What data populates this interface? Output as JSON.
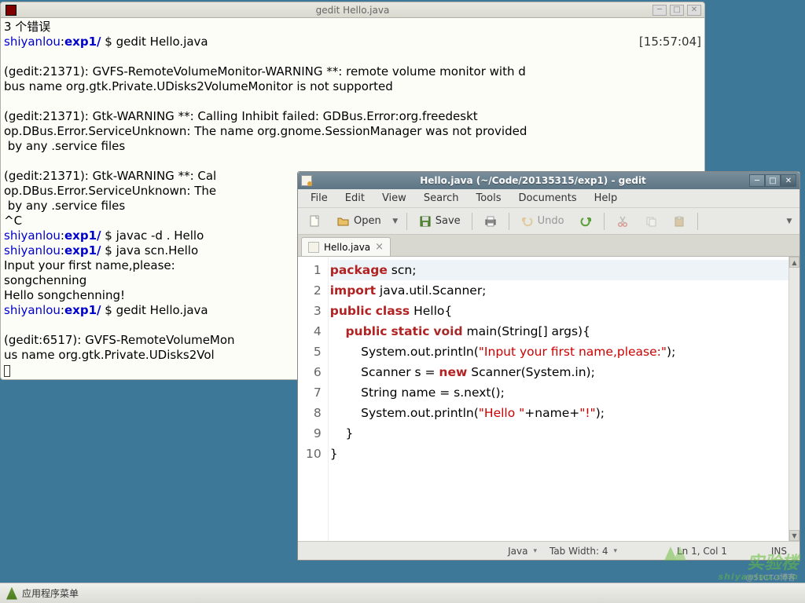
{
  "terminal": {
    "title": "gedit Hello.java",
    "lines": [
      {
        "segments": [
          {
            "t": "3 个错误"
          }
        ]
      },
      {
        "segments": [
          {
            "t": "shiyanlou",
            "cls": "prompt-host"
          },
          {
            "t": ":"
          },
          {
            "t": "exp1/",
            "cls": "prompt-path"
          },
          {
            "t": " $ gedit Hello.java"
          }
        ],
        "right": "[15:57:04]"
      },
      {
        "segments": [
          {
            "t": " "
          }
        ]
      },
      {
        "segments": [
          {
            "t": "(gedit:21371): GVFS-RemoteVolumeMonitor-WARNING **: remote volume monitor with d"
          }
        ]
      },
      {
        "segments": [
          {
            "t": "bus name org.gtk.Private.UDisks2VolumeMonitor is not supported"
          }
        ]
      },
      {
        "segments": [
          {
            "t": " "
          }
        ]
      },
      {
        "segments": [
          {
            "t": "(gedit:21371): Gtk-WARNING **: Calling Inhibit failed: GDBus.Error:org.freedeskt"
          }
        ]
      },
      {
        "segments": [
          {
            "t": "op.DBus.Error.ServiceUnknown: The name org.gnome.SessionManager was not provided"
          }
        ]
      },
      {
        "segments": [
          {
            "t": " by any .service files"
          }
        ]
      },
      {
        "segments": [
          {
            "t": " "
          }
        ]
      },
      {
        "segments": [
          {
            "t": "(gedit:21371): Gtk-WARNING **: Cal"
          }
        ]
      },
      {
        "segments": [
          {
            "t": "op.DBus.Error.ServiceUnknown: The "
          }
        ]
      },
      {
        "segments": [
          {
            "t": " by any .service files"
          }
        ]
      },
      {
        "segments": [
          {
            "t": "^C"
          }
        ]
      },
      {
        "segments": [
          {
            "t": "shiyanlou",
            "cls": "prompt-host"
          },
          {
            "t": ":"
          },
          {
            "t": "exp1/",
            "cls": "prompt-path"
          },
          {
            "t": " $ javac -d . Hello"
          }
        ]
      },
      {
        "segments": [
          {
            "t": "shiyanlou",
            "cls": "prompt-host"
          },
          {
            "t": ":"
          },
          {
            "t": "exp1/",
            "cls": "prompt-path"
          },
          {
            "t": " $ java scn.Hello"
          }
        ]
      },
      {
        "segments": [
          {
            "t": "Input your first name,please:"
          }
        ]
      },
      {
        "segments": [
          {
            "t": "songchenning"
          }
        ]
      },
      {
        "segments": [
          {
            "t": "Hello songchenning!"
          }
        ]
      },
      {
        "segments": [
          {
            "t": "shiyanlou",
            "cls": "prompt-host"
          },
          {
            "t": ":"
          },
          {
            "t": "exp1/",
            "cls": "prompt-path"
          },
          {
            "t": " $ gedit Hello.java"
          }
        ]
      },
      {
        "segments": [
          {
            "t": " "
          }
        ]
      },
      {
        "segments": [
          {
            "t": "(gedit:6517): GVFS-RemoteVolumeMon"
          }
        ]
      },
      {
        "segments": [
          {
            "t": "us name org.gtk.Private.UDisks2Vol"
          }
        ]
      }
    ]
  },
  "gedit": {
    "title": "Hello.java (~/Code/20135315/exp1) - gedit",
    "menus": [
      "File",
      "Edit",
      "View",
      "Search",
      "Tools",
      "Documents",
      "Help"
    ],
    "toolbar": {
      "open": "Open",
      "save": "Save",
      "undo": "Undo"
    },
    "tab": "Hello.java",
    "code_lines": [
      {
        "n": "1",
        "hl": true,
        "html": "<span class=\"kw\">package</span> scn;"
      },
      {
        "n": "2",
        "html": "<span class=\"kw\">import</span> java.util.Scanner;"
      },
      {
        "n": "3",
        "html": "<span class=\"kw\">public</span> <span class=\"kw\">class</span> Hello{"
      },
      {
        "n": "4",
        "html": "    <span class=\"kw\">public</span> <span class=\"kw\">static</span> <span class=\"kw2\">void</span> main(String[] args){"
      },
      {
        "n": "5",
        "html": "        System.out.println(<span class=\"str\">\"Input your first name,please:\"</span>);"
      },
      {
        "n": "6",
        "html": "        Scanner s = <span class=\"kw\">new</span> Scanner(System.in);"
      },
      {
        "n": "7",
        "html": "        String name = s.next();"
      },
      {
        "n": "8",
        "html": "        System.out.println(<span class=\"str\">\"Hello \"</span>+name+<span class=\"str\">\"!\"</span>);"
      },
      {
        "n": "9",
        "html": "    }"
      },
      {
        "n": "10",
        "html": "}"
      }
    ],
    "status": {
      "lang": "Java",
      "tabwidth": "Tab Width: 4",
      "pos": "Ln 1, Col 1",
      "ins": "INS"
    }
  },
  "taskbar": {
    "menu": "应用程序菜单"
  },
  "watermark": {
    "main": "实验楼",
    "sub": "shiyanlou.com"
  },
  "signature": "@51CTO博客"
}
